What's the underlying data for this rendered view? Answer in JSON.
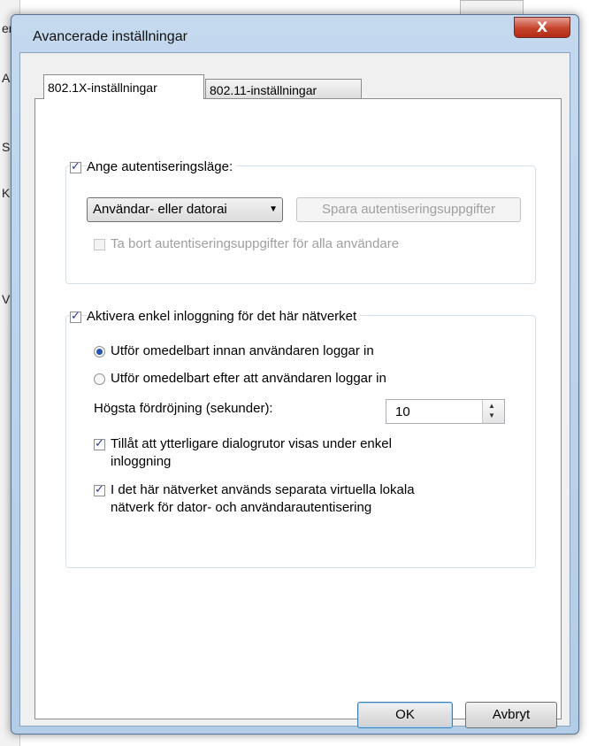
{
  "background": {
    "labels": [
      "en",
      "An",
      "S",
      "K",
      "V"
    ]
  },
  "dialog": {
    "title": "Avancerade inställningar",
    "close": "X",
    "tabs": [
      {
        "label": "802.1X-inställningar"
      },
      {
        "label": "802.11-inställningar"
      }
    ],
    "group1": {
      "checkbox_label": "Ange autentiseringsläge:",
      "checked": true,
      "mode_select": "Användar- eller datorai",
      "save_button": "Spara autentiseringsuppgifter",
      "delete_label": "Ta bort autentiseringsuppgifter för alla användare",
      "delete_checked": false
    },
    "group2": {
      "checkbox_label": "Aktivera enkel inloggning för det här nätverket",
      "checked": true,
      "radio1": "Utför omedelbart innan användaren loggar in",
      "radio1_selected": true,
      "radio2": "Utför omedelbart efter att användaren loggar in",
      "radio2_selected": false,
      "delay_label": "Högsta fördröjning (sekunder):",
      "delay_value": "10",
      "allow_label_1": "Tillåt att ytterligare dialogrutor visas under enkel",
      "allow_label_2": "inloggning",
      "allow_checked": true,
      "vlan_label_1": "I det här nätverket används separata virtuella lokala",
      "vlan_label_2": "nätverk för dator- och användarautentisering",
      "vlan_checked": true
    },
    "buttons": {
      "ok": "OK",
      "cancel": "Avbryt"
    }
  }
}
